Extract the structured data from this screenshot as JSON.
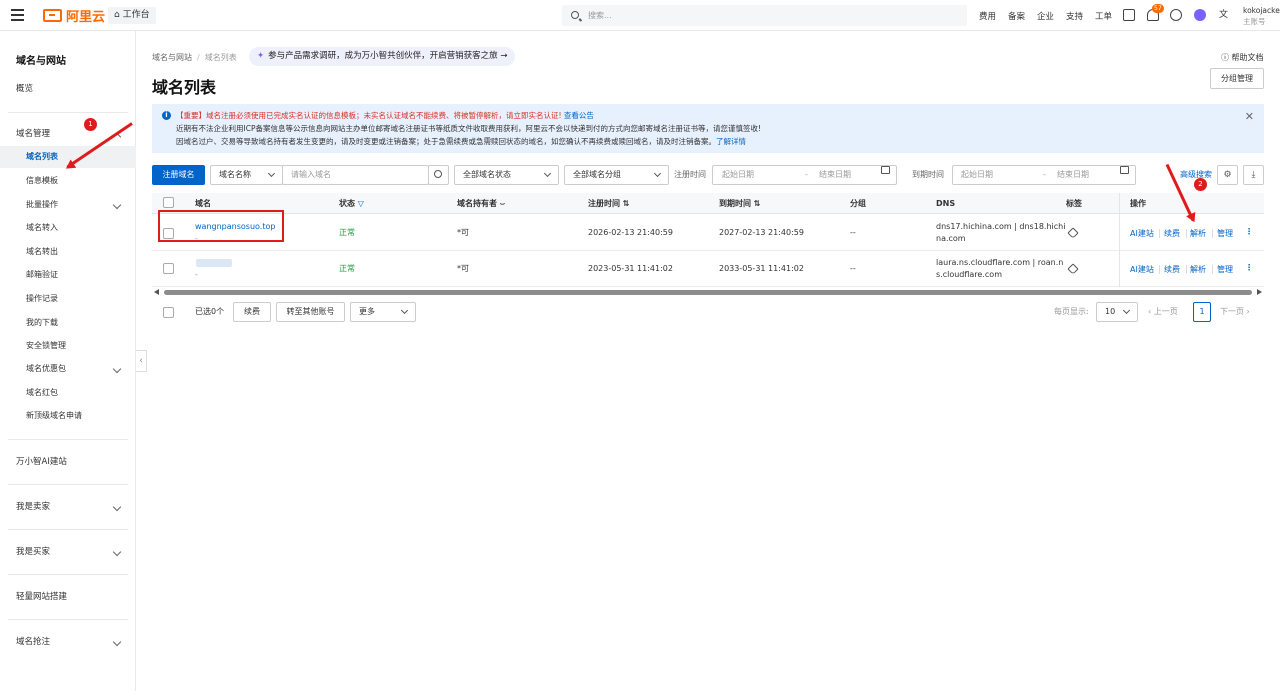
{
  "topbar": {
    "logo_text": "阿里云",
    "workbench": "工作台",
    "search_placeholder": "搜索...",
    "nav": [
      "费用",
      "备案",
      "企业",
      "支持",
      "工单"
    ],
    "notification_count": "57",
    "user_name": "kokojacket",
    "user_role": "主账号"
  },
  "sidebar": {
    "title": "域名与网站",
    "overview": "概览",
    "group_domain_mgmt": "域名管理",
    "items": [
      "域名列表",
      "信息模板",
      "批量操作",
      "域名转入",
      "域名转出",
      "邮箱验证",
      "操作记录",
      "我的下载",
      "安全锁管理",
      "域名优惠包",
      "域名红包",
      "新顶级域名申请"
    ],
    "sections": [
      "万小智AI建站",
      "我是卖家",
      "我是买家",
      "轻量网站搭建",
      "域名抢注"
    ]
  },
  "header": {
    "breadcrumb": [
      "域名与网站",
      "域名列表"
    ],
    "promo": "参与产品需求调研，成为万小智共创伙伴，开启营销获客之旅",
    "promo_arrow": "→",
    "title": "域名列表",
    "help": "帮助文档",
    "group_mgmt": "分组管理"
  },
  "notice": {
    "line1_red": "【重要】域名注册必须使用已完成实名认证的信息模板；未实名认证域名不能续费、将被暂停解析，请立即实名认证!",
    "line1_link": "查看公告",
    "line2": "近期有不法企业利用ICP备案信息等公示信息向网站主办单位邮寄域名注册证书等纸质文件收取费用获利，阿里云不会以快递到付的方式向您邮寄域名注册证书等，请您谨慎签收!",
    "line3": "因域名过户、交易等导致域名持有者发生变更的，请及时变更或注销备案；处于急需续费或急需赎回状态的域名，如您确认不再续费或赎回域名，请及时注销备案。",
    "line3_link": "了解详情"
  },
  "filters": {
    "register_btn": "注册域名",
    "search_type": "域名名称",
    "search_placeholder": "请输入域名",
    "status": "全部域名状态",
    "group": "全部域名分组",
    "reg_time_label": "注册时间",
    "exp_time_label": "到期时间",
    "start_date": "起始日期",
    "dash": "-",
    "end_date": "结束日期",
    "advanced": "高级搜索"
  },
  "table": {
    "headers": [
      "域名",
      "状态",
      "域名持有者",
      "注册时间",
      "到期时间",
      "分组",
      "DNS",
      "标签",
      "操作"
    ],
    "rows": [
      {
        "domain": "wangnpansosuo.top",
        "sub": "-",
        "status": "正常",
        "holder": "*可",
        "reg": "2026-02-13 21:40:59",
        "exp": "2027-02-13 21:40:59",
        "group": "--",
        "dns1": "dns17.hichina.com | dns18.hichi",
        "dns2": "na.com"
      },
      {
        "domain": "",
        "sub": "-",
        "status": "正常",
        "holder": "*可",
        "reg": "2023-05-31 11:41:02",
        "exp": "2033-05-31 11:41:02",
        "group": "--",
        "dns1": "laura.ns.cloudflare.com | roan.n",
        "dns2": "s.cloudflare.com"
      }
    ],
    "ops": [
      "AI建站",
      "续费",
      "解析",
      "管理"
    ],
    "more": "⋮"
  },
  "footer": {
    "selected": "已选0个",
    "renew": "续费",
    "transfer": "转至其他账号",
    "more": "更多",
    "per_page_label": "每页显示:",
    "per_page": "10",
    "prev": "上一页",
    "page": "1",
    "next": "下一页"
  },
  "annotations": {
    "one": "1",
    "two": "2"
  },
  "colors": {
    "brand": "#ff6a00",
    "primary": "#0064c8",
    "success": "#1b9d3a",
    "annotation": "#e01b1b"
  }
}
